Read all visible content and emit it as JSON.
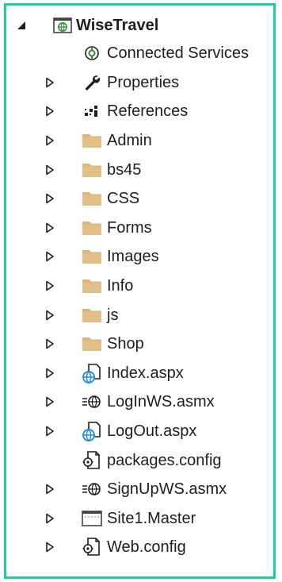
{
  "solution_explorer": {
    "project": {
      "label": "WiseTravel",
      "expanded": true,
      "icon": "web-project-icon"
    },
    "items": [
      {
        "label": "Connected Services",
        "icon": "connected-services-icon",
        "expandable": false
      },
      {
        "label": "Properties",
        "icon": "wrench-icon",
        "expandable": true
      },
      {
        "label": "References",
        "icon": "references-icon",
        "expandable": true
      },
      {
        "label": "Admin",
        "icon": "folder-icon",
        "expandable": true
      },
      {
        "label": "bs45",
        "icon": "folder-icon",
        "expandable": true
      },
      {
        "label": "CSS",
        "icon": "folder-icon",
        "expandable": true
      },
      {
        "label": "Forms",
        "icon": "folder-icon",
        "expandable": true
      },
      {
        "label": "Images",
        "icon": "folder-icon",
        "expandable": true
      },
      {
        "label": "Info",
        "icon": "folder-icon",
        "expandable": true
      },
      {
        "label": "js",
        "icon": "folder-icon",
        "expandable": true
      },
      {
        "label": "Shop",
        "icon": "folder-icon",
        "expandable": true
      },
      {
        "label": "Index.aspx",
        "icon": "aspx-page-icon",
        "expandable": true
      },
      {
        "label": "LogInWS.asmx",
        "icon": "web-service-icon",
        "expandable": true
      },
      {
        "label": "LogOut.aspx",
        "icon": "aspx-page-icon",
        "expandable": true
      },
      {
        "label": "packages.config",
        "icon": "config-file-icon",
        "expandable": false
      },
      {
        "label": "SignUpWS.asmx",
        "icon": "web-service-icon",
        "expandable": true
      },
      {
        "label": "Site1.Master",
        "icon": "master-page-icon",
        "expandable": true
      },
      {
        "label": "Web.config",
        "icon": "config-file-icon",
        "expandable": true
      }
    ],
    "colors": {
      "frame_border": "#19d39a",
      "folder": "#dcb67a",
      "globe": "#1e88e5",
      "connected": "#388a34",
      "text": "#1e1e1e"
    }
  }
}
